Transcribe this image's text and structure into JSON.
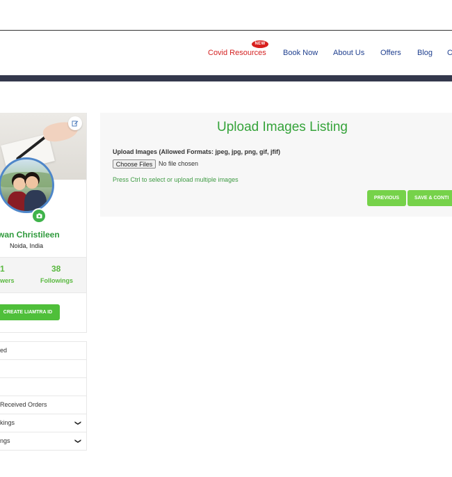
{
  "nav": {
    "items": [
      {
        "label": "Covid Resources",
        "badge": "NEW"
      },
      {
        "label": "Book Now"
      },
      {
        "label": "About Us"
      },
      {
        "label": "Offers"
      },
      {
        "label": "Blog"
      },
      {
        "label": "C"
      }
    ]
  },
  "profile": {
    "name": "wan Christileen",
    "location": "Noida, India",
    "followers_count": "1",
    "followers_label": "wers",
    "followings_count": "38",
    "followings_label": "Followings",
    "create_button": "CREATE LIAMTRA ID"
  },
  "sidebar_menu": [
    {
      "label": "ed",
      "has_chevron": false
    },
    {
      "label": "",
      "has_chevron": false
    },
    {
      "label": "",
      "has_chevron": false
    },
    {
      "label": "Received Orders",
      "has_chevron": false
    },
    {
      "label": "kings",
      "has_chevron": true
    },
    {
      "label": "ngs",
      "has_chevron": true
    }
  ],
  "upload": {
    "title": "Upload Images Listing",
    "label": "Upload Images (Allowed Formats: jpeg, jpg, png, gif, jfif)",
    "choose_button": "Choose Files",
    "file_status": "No file chosen",
    "hint": "Press Ctrl to select or upload multiple images",
    "previous_button": "PREVIOUS",
    "save_button": "SAVE & CONTI"
  },
  "colors": {
    "accent_green": "#35a33a",
    "button_green": "#76d24a",
    "nav_blue": "#1f3f8f",
    "nav_red": "#d42222",
    "dark_bar": "#34384c"
  },
  "icons": {
    "edit": "edit-icon",
    "camera": "camera-icon",
    "chevron": "chevron-down-icon"
  }
}
